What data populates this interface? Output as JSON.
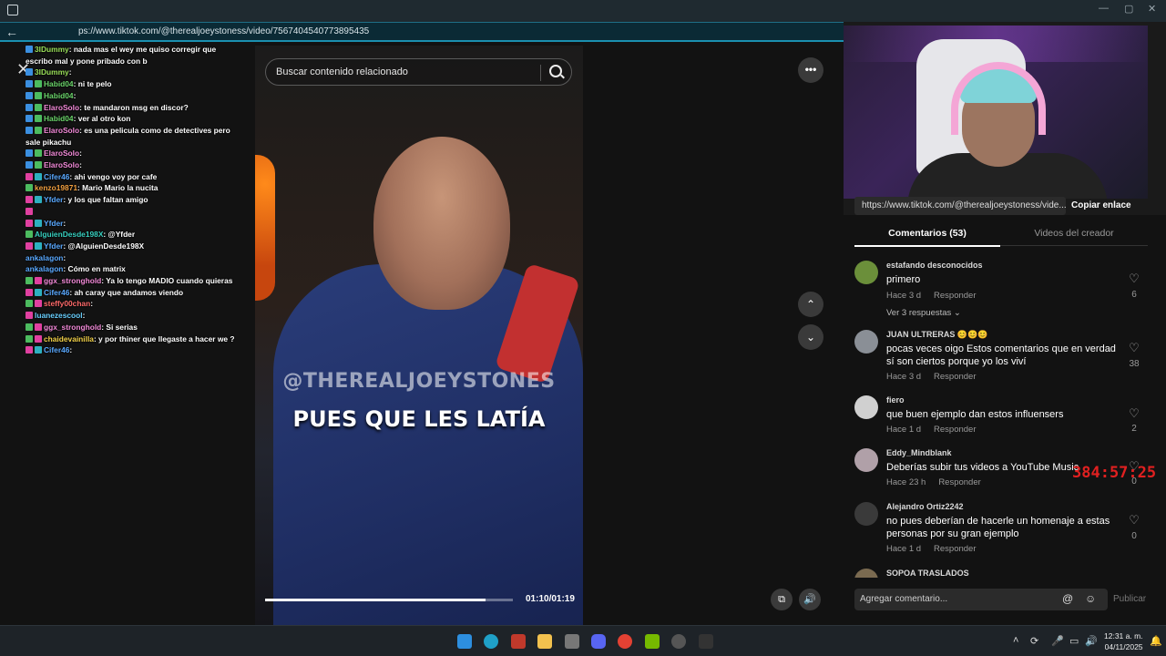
{
  "browser": {
    "url": "ps://www.tiktok.com/@therealjoeystoness/video/7567404540773895435"
  },
  "chat": [
    {
      "user": "3IDummy",
      "text": ": nada mas el wey me quiso corregir que escribo mal y pone pribado con b",
      "color": "u-lime",
      "wrap": true,
      "badges": [
        "b-blue"
      ]
    },
    {
      "user": "3IDummy",
      "text": ":",
      "color": "u-lime",
      "badges": [
        "b-blue"
      ]
    },
    {
      "user": "Habid04",
      "text": ": ni te pelo",
      "color": "u-green",
      "badges": [
        "b-blue",
        "b-green"
      ]
    },
    {
      "user": "Habid04",
      "text": ":",
      "color": "u-green",
      "badges": [
        "b-blue",
        "b-green"
      ]
    },
    {
      "user": "ElaroSolo",
      "text": ": te mandaron msg en discor?",
      "color": "u-pink",
      "badges": [
        "b-blue",
        "b-green"
      ]
    },
    {
      "user": "Habid04",
      "text": ": ver al otro kon",
      "color": "u-green",
      "badges": [
        "b-blue",
        "b-green"
      ]
    },
    {
      "user": "ElaroSolo",
      "text": ": es una pelicula como de detectives pero sale pikachu",
      "color": "u-pink",
      "wrap": true,
      "badges": [
        "b-blue",
        "b-green"
      ]
    },
    {
      "user": "ElaroSolo",
      "text": ":",
      "color": "u-pink",
      "badges": [
        "b-blue",
        "b-green"
      ]
    },
    {
      "user": "ElaroSolo",
      "text": ":",
      "color": "u-pink",
      "badges": [
        "b-blue",
        "b-green"
      ]
    },
    {
      "user": "Cifer46",
      "text": ": ahi vengo voy por cafe",
      "color": "u-blue",
      "badges": [
        "b-pink",
        "b-teal"
      ]
    },
    {
      "user": "",
      "text": "",
      "color": "u-blue",
      "badges": []
    },
    {
      "user": "kenzo19871",
      "text": ": Mario Mario la nucita",
      "color": "u-orange",
      "badges": [
        "b-green"
      ]
    },
    {
      "user": "Yfder",
      "text": ": y los que faltan amigo",
      "color": "u-blue",
      "badges": [
        "b-pink",
        "b-teal"
      ]
    },
    {
      "user": "",
      "text": "",
      "color": "u-blue",
      "badges": [
        "b-pink"
      ]
    },
    {
      "user": "Yfder",
      "text": ":",
      "color": "u-blue",
      "badges": [
        "b-pink",
        "b-teal"
      ]
    },
    {
      "user": "AlguienDesde198X",
      "text": ": @Yfder",
      "color": "u-teal",
      "badges": [
        "b-green"
      ]
    },
    {
      "user": "Yfder",
      "text": ": @AlguienDesde198X",
      "color": "u-blue",
      "badges": [
        "b-pink",
        "b-teal"
      ]
    },
    {
      "user": "ankalagon",
      "text": ":",
      "color": "u-blue",
      "badges": []
    },
    {
      "user": "ankalagon",
      "text": ": Cómo en matrix",
      "color": "u-blue",
      "badges": []
    },
    {
      "user": "ggx_stronghold",
      "text": ": Ya lo tengo MADIO cuando quieras",
      "color": "u-pink",
      "wrap": true,
      "badges": [
        "b-green",
        "b-pink"
      ]
    },
    {
      "user": "Cifer46",
      "text": ": ah caray que andamos viendo",
      "color": "u-blue",
      "wrap": true,
      "badges": [
        "b-pink",
        "b-teal"
      ]
    },
    {
      "user": "steffy00chan",
      "text": ":",
      "color": "u-red",
      "badges": [
        "b-green",
        "b-pink"
      ]
    },
    {
      "user": "luanezescool",
      "text": ":",
      "color": "u-cyan",
      "badges": [
        "b-pink"
      ]
    },
    {
      "user": "ggx_stronghold",
      "text": ": Si serias",
      "color": "u-pink",
      "badges": [
        "b-green",
        "b-pink"
      ]
    },
    {
      "user": "chaidevainilla",
      "text": ": y por thiner que llegaste a hacer we ?",
      "color": "u-yellow",
      "wrap": true,
      "badges": [
        "b-green",
        "b-pink"
      ]
    },
    {
      "user": "Cifer46",
      "text": ":",
      "color": "u-blue",
      "badges": [
        "b-pink",
        "b-teal"
      ]
    }
  ],
  "video": {
    "search_placeholder": "Buscar contenido relacionado",
    "watermark": "@THEREALJOEYSTONES",
    "caption": "PUES QUE LES LATÍA",
    "time": "01:10/01:19",
    "progress": 0.89
  },
  "webcam": {
    "link": "https://www.tiktok.com/@therealjoeystoness/vide...",
    "copy_label": "Copiar enlace"
  },
  "tabs": {
    "comments": "Comentarios (53)",
    "creator_videos": "Videos del creador"
  },
  "comments": [
    {
      "user": "estafando desconocidos",
      "text": "primero",
      "time": "Hace 3 d",
      "reply": "Responder",
      "likes": "6",
      "more": "Ver 3 respuestas",
      "avatar": "#6b8f3a"
    },
    {
      "user": "JUAN ULTRERAS",
      "text": "pocas veces oigo Estos comentarios que en verdad sí son ciertos porque yo los viví",
      "time": "Hace 3 d",
      "reply": "Responder",
      "likes": "38",
      "avatar": "#8a8f96"
    },
    {
      "user": "fiero",
      "text": "que buen ejemplo dan estos influensers",
      "time": "Hace 1 d",
      "reply": "Responder",
      "likes": "2",
      "avatar": "#d0d0d0"
    },
    {
      "user": "Eddy_Mindblank",
      "text": "Deberías subir tus videos a YouTube Music",
      "time": "Hace 23 h",
      "reply": "Responder",
      "likes": "0",
      "avatar": "#b0a0a8"
    },
    {
      "user": "Alejandro Ortiz2242",
      "text": "no pues deberían de hacerle un homenaje a estas personas por su gran ejemplo",
      "time": "Hace 1 d",
      "reply": "Responder",
      "likes": "0",
      "avatar": "#3a3a3a"
    },
    {
      "user": "SOPOA TRASLADOS",
      "text": "",
      "time": "",
      "reply": "",
      "likes": "",
      "avatar": "#7a6a50"
    }
  ],
  "timer": "384:57:25",
  "composer": {
    "placeholder": "Agregar comentario...",
    "publish": "Publicar"
  },
  "taskbar": {
    "time": "12:31 a. m.",
    "date": "04/11/2025"
  }
}
